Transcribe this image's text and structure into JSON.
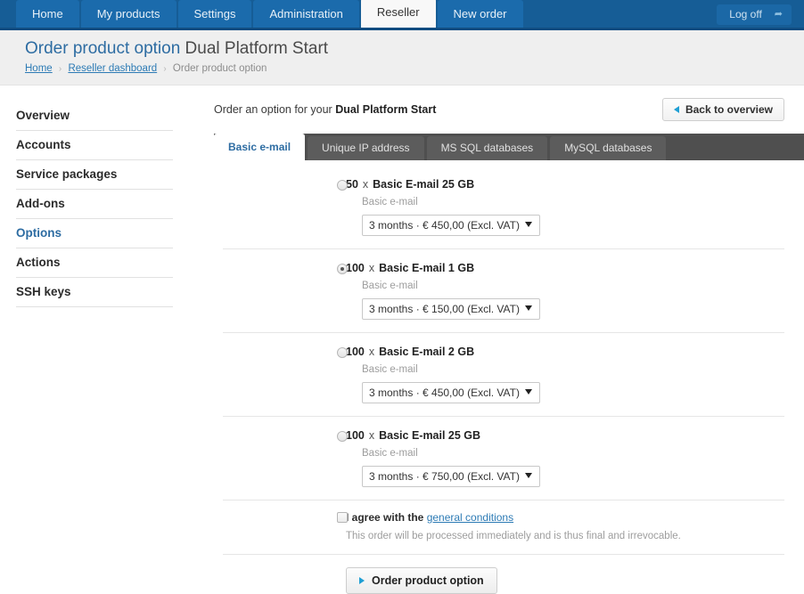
{
  "topnav": {
    "items": [
      {
        "label": "Home",
        "active": false
      },
      {
        "label": "My products",
        "active": false
      },
      {
        "label": "Settings",
        "active": false
      },
      {
        "label": "Administration",
        "active": false
      },
      {
        "label": "Reseller",
        "active": true
      },
      {
        "label": "New order",
        "active": false
      }
    ],
    "logoff_label": "Log off",
    "logoff_icon": "arrow-right-icon"
  },
  "header": {
    "title_primary": "Order product option",
    "title_secondary": "Dual Platform Start",
    "breadcrumb": {
      "home": "Home",
      "dashboard": "Reseller dashboard",
      "current": "Order product option",
      "separator": "›"
    }
  },
  "sidebar": {
    "items": [
      {
        "label": "Overview",
        "active": false
      },
      {
        "label": "Accounts",
        "active": false
      },
      {
        "label": "Service packages",
        "active": false
      },
      {
        "label": "Add-ons",
        "active": false
      },
      {
        "label": "Options",
        "active": true
      },
      {
        "label": "Actions",
        "active": false
      },
      {
        "label": "SSH keys",
        "active": false
      }
    ]
  },
  "content": {
    "lead_prefix": "Order an option for your ",
    "lead_product": "Dual Platform Start",
    "back_button": "Back to overview",
    "back_icon": "triangle-left-icon"
  },
  "tabs": [
    {
      "label": "Basic e-mail",
      "active": true
    },
    {
      "label": "Unique IP address",
      "active": false
    },
    {
      "label": "MS SQL databases",
      "active": false
    },
    {
      "label": "MySQL databases",
      "active": false
    }
  ],
  "options": [
    {
      "quantity": "50",
      "multiplier": "x",
      "name": "Basic E-mail 25 GB",
      "category": "Basic e-mail",
      "selected": false,
      "term": "3 months · € 450,00 (Excl. VAT)"
    },
    {
      "quantity": "100",
      "multiplier": "x",
      "name": "Basic E-mail 1 GB",
      "category": "Basic e-mail",
      "selected": true,
      "term": "3 months · € 150,00 (Excl. VAT)"
    },
    {
      "quantity": "100",
      "multiplier": "x",
      "name": "Basic E-mail 2 GB",
      "category": "Basic e-mail",
      "selected": false,
      "term": "3 months · € 450,00 (Excl. VAT)"
    },
    {
      "quantity": "100",
      "multiplier": "x",
      "name": "Basic E-mail 25 GB",
      "category": "Basic e-mail",
      "selected": false,
      "term": "3 months · € 750,00 (Excl. VAT)"
    }
  ],
  "agreement": {
    "checked": false,
    "label_prefix": "I agree with the ",
    "link_label": "general conditions",
    "note": "This order will be processed immediately and is thus final and irrevocable."
  },
  "submit": {
    "label": "Order product option",
    "icon": "triangle-right-icon"
  },
  "colors": {
    "nav_blue": "#165d96",
    "nav_tab_blue": "#1b6bac",
    "link_blue": "#2d7bb5",
    "title_blue": "#2d6ca2",
    "tabbar_gray": "#4f4f4f",
    "tab_gray": "#5c5c5c",
    "header_gray": "#efefef",
    "accent_triangle": "#1f9fd4"
  }
}
